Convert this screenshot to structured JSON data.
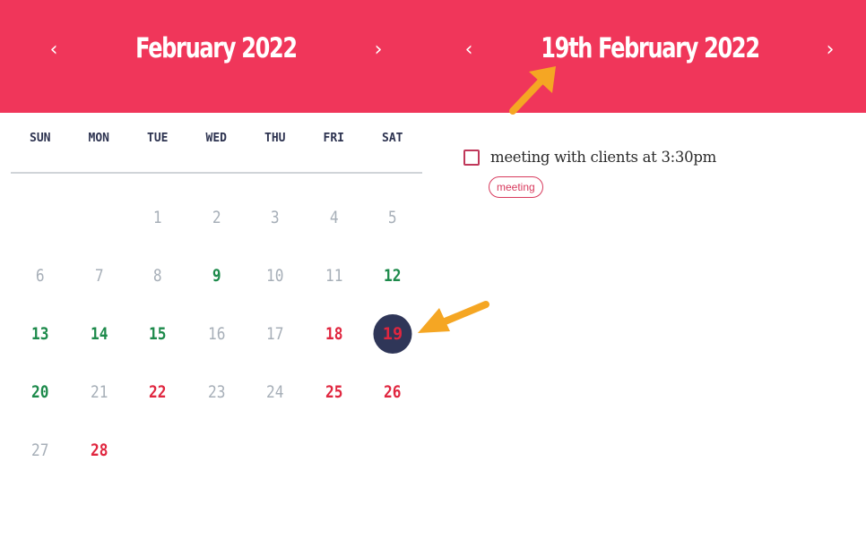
{
  "calendar": {
    "month_title": "February 2022",
    "prev_month_glyph": "‹",
    "next_month_glyph": "›",
    "weekdays": [
      "SUN",
      "MON",
      "TUE",
      "WED",
      "THU",
      "FRI",
      "SAT"
    ],
    "days": [
      {
        "label": "",
        "style": "empty"
      },
      {
        "label": "",
        "style": "empty"
      },
      {
        "label": "1",
        "style": "muted"
      },
      {
        "label": "2",
        "style": "muted"
      },
      {
        "label": "3",
        "style": "muted"
      },
      {
        "label": "4",
        "style": "muted"
      },
      {
        "label": "5",
        "style": "muted"
      },
      {
        "label": "6",
        "style": "muted"
      },
      {
        "label": "7",
        "style": "muted"
      },
      {
        "label": "8",
        "style": "muted"
      },
      {
        "label": "9",
        "style": "green"
      },
      {
        "label": "10",
        "style": "muted"
      },
      {
        "label": "11",
        "style": "muted"
      },
      {
        "label": "12",
        "style": "green"
      },
      {
        "label": "13",
        "style": "green"
      },
      {
        "label": "14",
        "style": "green"
      },
      {
        "label": "15",
        "style": "green"
      },
      {
        "label": "16",
        "style": "muted"
      },
      {
        "label": "17",
        "style": "muted"
      },
      {
        "label": "18",
        "style": "red"
      },
      {
        "label": "19",
        "style": "selected"
      },
      {
        "label": "20",
        "style": "green"
      },
      {
        "label": "21",
        "style": "muted"
      },
      {
        "label": "22",
        "style": "red"
      },
      {
        "label": "23",
        "style": "muted"
      },
      {
        "label": "24",
        "style": "muted"
      },
      {
        "label": "25",
        "style": "red"
      },
      {
        "label": "26",
        "style": "red"
      },
      {
        "label": "27",
        "style": "muted"
      },
      {
        "label": "28",
        "style": "red"
      }
    ]
  },
  "day_view": {
    "title": "19th February 2022",
    "prev_day_glyph": "‹",
    "next_day_glyph": "›",
    "tasks": [
      {
        "text": "meeting with clients at 3:30pm",
        "checked": false,
        "tag": "meeting"
      }
    ]
  },
  "colors": {
    "accent": "#f0365a",
    "selected_day_bg": "#2f3658",
    "green_day": "#1d8a4b",
    "red_day": "#e0263f",
    "annotation_arrow": "#f5a623"
  }
}
